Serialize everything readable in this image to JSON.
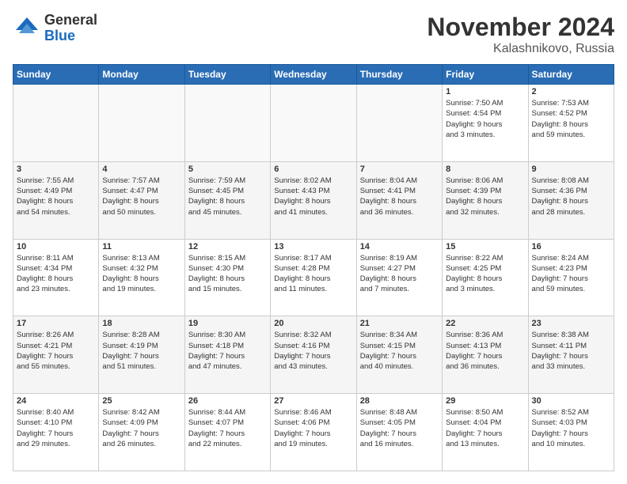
{
  "logo": {
    "general": "General",
    "blue": "Blue"
  },
  "title": "November 2024",
  "location": "Kalashnikovo, Russia",
  "days_of_week": [
    "Sunday",
    "Monday",
    "Tuesday",
    "Wednesday",
    "Thursday",
    "Friday",
    "Saturday"
  ],
  "weeks": [
    [
      {
        "day": "",
        "info": ""
      },
      {
        "day": "",
        "info": ""
      },
      {
        "day": "",
        "info": ""
      },
      {
        "day": "",
        "info": ""
      },
      {
        "day": "",
        "info": ""
      },
      {
        "day": "1",
        "info": "Sunrise: 7:50 AM\nSunset: 4:54 PM\nDaylight: 9 hours\nand 3 minutes."
      },
      {
        "day": "2",
        "info": "Sunrise: 7:53 AM\nSunset: 4:52 PM\nDaylight: 8 hours\nand 59 minutes."
      }
    ],
    [
      {
        "day": "3",
        "info": "Sunrise: 7:55 AM\nSunset: 4:49 PM\nDaylight: 8 hours\nand 54 minutes."
      },
      {
        "day": "4",
        "info": "Sunrise: 7:57 AM\nSunset: 4:47 PM\nDaylight: 8 hours\nand 50 minutes."
      },
      {
        "day": "5",
        "info": "Sunrise: 7:59 AM\nSunset: 4:45 PM\nDaylight: 8 hours\nand 45 minutes."
      },
      {
        "day": "6",
        "info": "Sunrise: 8:02 AM\nSunset: 4:43 PM\nDaylight: 8 hours\nand 41 minutes."
      },
      {
        "day": "7",
        "info": "Sunrise: 8:04 AM\nSunset: 4:41 PM\nDaylight: 8 hours\nand 36 minutes."
      },
      {
        "day": "8",
        "info": "Sunrise: 8:06 AM\nSunset: 4:39 PM\nDaylight: 8 hours\nand 32 minutes."
      },
      {
        "day": "9",
        "info": "Sunrise: 8:08 AM\nSunset: 4:36 PM\nDaylight: 8 hours\nand 28 minutes."
      }
    ],
    [
      {
        "day": "10",
        "info": "Sunrise: 8:11 AM\nSunset: 4:34 PM\nDaylight: 8 hours\nand 23 minutes."
      },
      {
        "day": "11",
        "info": "Sunrise: 8:13 AM\nSunset: 4:32 PM\nDaylight: 8 hours\nand 19 minutes."
      },
      {
        "day": "12",
        "info": "Sunrise: 8:15 AM\nSunset: 4:30 PM\nDaylight: 8 hours\nand 15 minutes."
      },
      {
        "day": "13",
        "info": "Sunrise: 8:17 AM\nSunset: 4:28 PM\nDaylight: 8 hours\nand 11 minutes."
      },
      {
        "day": "14",
        "info": "Sunrise: 8:19 AM\nSunset: 4:27 PM\nDaylight: 8 hours\nand 7 minutes."
      },
      {
        "day": "15",
        "info": "Sunrise: 8:22 AM\nSunset: 4:25 PM\nDaylight: 8 hours\nand 3 minutes."
      },
      {
        "day": "16",
        "info": "Sunrise: 8:24 AM\nSunset: 4:23 PM\nDaylight: 7 hours\nand 59 minutes."
      }
    ],
    [
      {
        "day": "17",
        "info": "Sunrise: 8:26 AM\nSunset: 4:21 PM\nDaylight: 7 hours\nand 55 minutes."
      },
      {
        "day": "18",
        "info": "Sunrise: 8:28 AM\nSunset: 4:19 PM\nDaylight: 7 hours\nand 51 minutes."
      },
      {
        "day": "19",
        "info": "Sunrise: 8:30 AM\nSunset: 4:18 PM\nDaylight: 7 hours\nand 47 minutes."
      },
      {
        "day": "20",
        "info": "Sunrise: 8:32 AM\nSunset: 4:16 PM\nDaylight: 7 hours\nand 43 minutes."
      },
      {
        "day": "21",
        "info": "Sunrise: 8:34 AM\nSunset: 4:15 PM\nDaylight: 7 hours\nand 40 minutes."
      },
      {
        "day": "22",
        "info": "Sunrise: 8:36 AM\nSunset: 4:13 PM\nDaylight: 7 hours\nand 36 minutes."
      },
      {
        "day": "23",
        "info": "Sunrise: 8:38 AM\nSunset: 4:11 PM\nDaylight: 7 hours\nand 33 minutes."
      }
    ],
    [
      {
        "day": "24",
        "info": "Sunrise: 8:40 AM\nSunset: 4:10 PM\nDaylight: 7 hours\nand 29 minutes."
      },
      {
        "day": "25",
        "info": "Sunrise: 8:42 AM\nSunset: 4:09 PM\nDaylight: 7 hours\nand 26 minutes."
      },
      {
        "day": "26",
        "info": "Sunrise: 8:44 AM\nSunset: 4:07 PM\nDaylight: 7 hours\nand 22 minutes."
      },
      {
        "day": "27",
        "info": "Sunrise: 8:46 AM\nSunset: 4:06 PM\nDaylight: 7 hours\nand 19 minutes."
      },
      {
        "day": "28",
        "info": "Sunrise: 8:48 AM\nSunset: 4:05 PM\nDaylight: 7 hours\nand 16 minutes."
      },
      {
        "day": "29",
        "info": "Sunrise: 8:50 AM\nSunset: 4:04 PM\nDaylight: 7 hours\nand 13 minutes."
      },
      {
        "day": "30",
        "info": "Sunrise: 8:52 AM\nSunset: 4:03 PM\nDaylight: 7 hours\nand 10 minutes."
      }
    ]
  ]
}
